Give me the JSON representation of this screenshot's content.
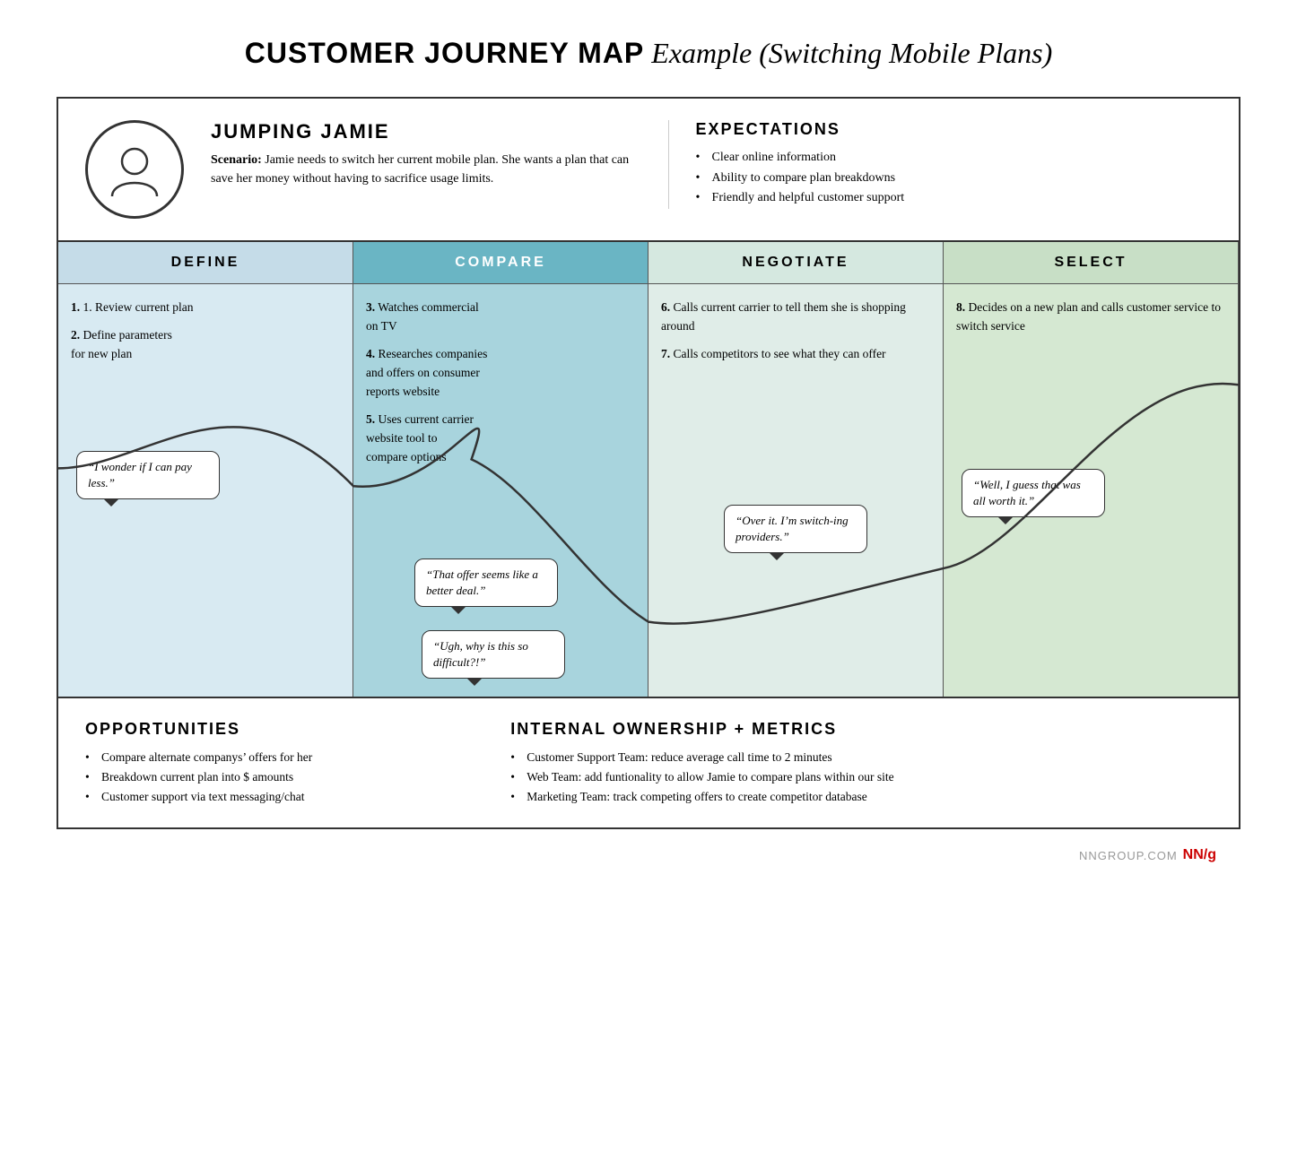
{
  "title": {
    "bold": "CUSTOMER JOURNEY MAP",
    "italic": "Example (Switching Mobile Plans)"
  },
  "persona": {
    "name": "JUMPING JAMIE",
    "scenario_label": "Scenario:",
    "scenario_text": "Jamie needs to switch her current mobile plan. She wants a plan that can save her money without having to sacrifice usage limits."
  },
  "expectations": {
    "title": "EXPECTATIONS",
    "items": [
      "Clear online information",
      "Ability to compare plan breakdowns",
      "Friendly and helpful customer support"
    ]
  },
  "columns": [
    {
      "id": "define",
      "header": "DEFINE",
      "steps": [
        "1. Review current plan",
        "2. Define parameters for new plan"
      ],
      "bubble": "“I wonder if I can pay less.”"
    },
    {
      "id": "compare",
      "header": "COMPARE",
      "steps": [
        "3. Watches commercial on TV",
        "4. Researches companies and offers on consumer reports website",
        "5. Uses current carrier website tool to compare options"
      ],
      "bubble_mid": "“That offer seems like a better deal.”",
      "bubble_low": "“Ugh, why is this so difficult?!”"
    },
    {
      "id": "negotiate",
      "header": "NEGOTIATE",
      "steps": [
        "6. Calls current carrier to tell them she is shopping around",
        "7. Calls competitors to see what they can offer"
      ],
      "bubble": "“Over it. I’m switch-ing providers.”"
    },
    {
      "id": "select",
      "header": "SELECT",
      "steps": [
        "8. Decides on a new plan and calls customer service to switch service"
      ],
      "bubble": "“Well, I guess that was all worth it.”"
    }
  ],
  "opportunities": {
    "title": "OPPORTUNITIES",
    "items": [
      "Compare alternate companys’ offers for her",
      "Breakdown current plan into $ amounts",
      "Customer support via text messaging/chat"
    ]
  },
  "internal": {
    "title": "INTERNAL OWNERSHIP + METRICS",
    "items": [
      "Customer Support Team: reduce average call time to 2 minutes",
      "Web Team: add funtionality to allow Jamie to compare plans within our site",
      "Marketing Team: track competing offers to create competitor database"
    ]
  },
  "footer": {
    "text": "NNGROUP.COM",
    "brand": "NN",
    "brand_accent": "/g"
  }
}
